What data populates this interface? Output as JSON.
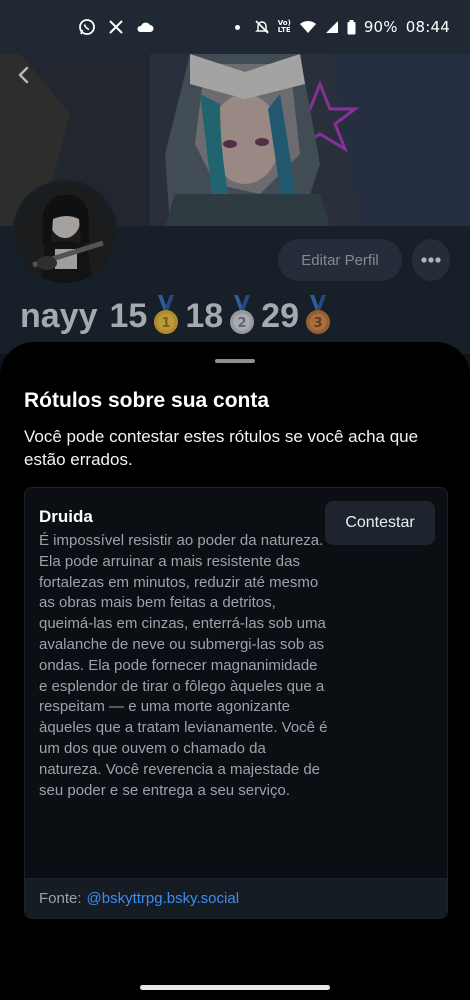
{
  "status_bar": {
    "battery": "90%",
    "time": "08:44",
    "network_top": "Vo)",
    "network_bottom": "LTE",
    "icons": [
      "whatsapp-icon",
      "x-icon",
      "cloud-icon",
      "dot-icon",
      "mute-icon",
      "lte-icon",
      "wifi-icon",
      "signal-icon",
      "battery-icon"
    ]
  },
  "profile": {
    "edit_button": "Editar Perfil",
    "name_prefix": "nayy",
    "medals": [
      {
        "number": "15",
        "rank": "1"
      },
      {
        "number": "18",
        "rank": "2"
      },
      {
        "number": "29",
        "rank": "3"
      }
    ],
    "colors": {
      "gold": "#e8b533",
      "silver": "#c4c8cf",
      "bronze": "#c9773c",
      "ribbon": "#3b78c9"
    }
  },
  "sheet": {
    "title": "Rótulos sobre sua conta",
    "description": "Você pode contestar estes rótulos se você acha que estão errados.",
    "label": {
      "name": "Druida",
      "contest_button": "Contestar",
      "description": "É impossível resistir ao poder da natureza. Ela pode arruinar a mais resistente das fortalezas em minutos, reduzir até mesmo as obras mais bem feitas a detritos, queimá-las em cinzas, enterrá-las sob uma avalanche de neve ou submergi-las sob as ondas. Ela pode fornecer magnanimidade e esplendor de tirar o fôlego àqueles que a respeitam — e uma morte agonizante àqueles que a tratam levianamente. Você é um dos que ouvem o chamado da natureza. Você reverencia a majestade de seu poder e se entrega a seu serviço.",
      "source_prefix": "Fonte:",
      "source_handle": "@bskyttrpg.bsky.social"
    }
  },
  "colors": {
    "link": "#3d8cf0",
    "sheet_bg": "#000000",
    "accent_button": "#1d242d"
  }
}
